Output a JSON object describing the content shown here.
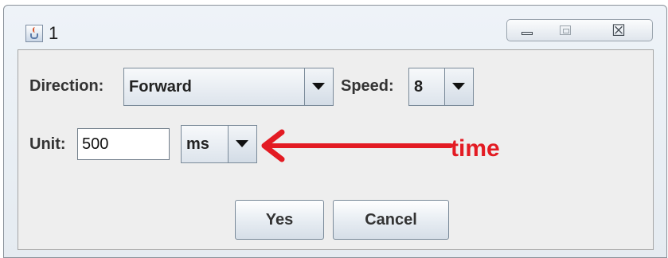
{
  "window": {
    "title": "1",
    "icons": {
      "app": "java-cup-icon",
      "minimize": "minimize-icon",
      "maximize": "maximize-icon",
      "close": "close-icon"
    },
    "close_glyph": "☒"
  },
  "form": {
    "direction": {
      "label": "Direction:",
      "value": "Forward"
    },
    "speed": {
      "label": "Speed:",
      "value": "8"
    },
    "unit": {
      "label": "Unit:",
      "value": "500",
      "unit_value": "ms"
    }
  },
  "buttons": {
    "yes": "Yes",
    "cancel": "Cancel"
  },
  "annotation": {
    "text": "time",
    "color": "#e31b23"
  }
}
